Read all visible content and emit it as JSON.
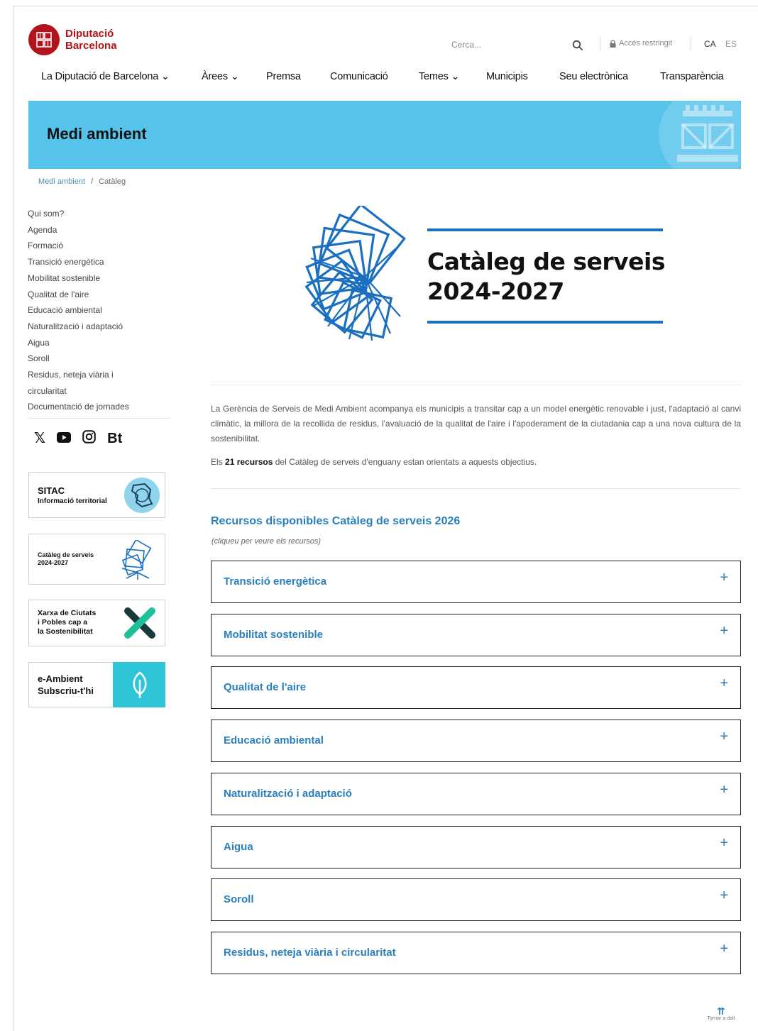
{
  "header": {
    "logo_line1": "Diputació",
    "logo_line2": "Barcelona",
    "search_placeholder": "Cerca...",
    "restricted": "Accés restringit",
    "lang_active": "CA",
    "lang_alt": "ES"
  },
  "nav": {
    "items": [
      {
        "label": "La Diputació de Barcelona ⌄"
      },
      {
        "label": "Àrees ⌄"
      },
      {
        "label": "Premsa"
      },
      {
        "label": "Comunicació"
      },
      {
        "label": "Temes ⌄"
      },
      {
        "label": "Municipis"
      },
      {
        "label": "Seu electrònica"
      },
      {
        "label": "Transparència"
      }
    ]
  },
  "banner": {
    "title": "Medi ambient"
  },
  "breadcrumb": {
    "home": "Medi ambient",
    "separator": "/",
    "current": "Catàleg"
  },
  "sidebar": {
    "items": [
      {
        "label": "Qui som?"
      },
      {
        "label": "Agenda"
      },
      {
        "label": "Formació"
      },
      {
        "label": "Transició energètica"
      },
      {
        "label": "Mobilitat sostenible"
      },
      {
        "label": "Qualitat de l'aire"
      },
      {
        "label": "Educació ambiental"
      },
      {
        "label": "Naturalització i adaptació"
      },
      {
        "label": "Aigua"
      },
      {
        "label": "Soroll"
      },
      {
        "label": "Residus, neteja viària i"
      },
      {
        "label": "circularitat"
      },
      {
        "label": "Documentació de jornades"
      }
    ],
    "social": {
      "x": "𝕏",
      "youtube": "▶",
      "instagram": "◎",
      "bt": "Bt"
    },
    "cards": {
      "sitac_title": "SITAC",
      "sitac_sub": "Informació territorial",
      "cataleg_line1": "Catàleg de serveis",
      "cataleg_line2": "2024-2027",
      "xarxa_line1": "Xarxa de Ciutats",
      "xarxa_line2": "i Pobles cap a",
      "xarxa_line3": "la Sostenibilitat",
      "eamb_line1": "e-Ambient",
      "eamb_line2": "Subscriu-t'hi"
    }
  },
  "hero": {
    "title_line1": "Catàleg de serveis",
    "title_line2": "2024-2027"
  },
  "main": {
    "intro": "La Gerència de Serveis de Medi Ambient acompanya els municipis a transitar cap a un model energètic renovable i just, l'adaptació al canvi climàtic, la millora de la recollida de residus, l'avaluació de la qualitat de l'aire i l'apoderament de la ciutadania cap a una nova cultura de la sostenibilitat.",
    "count_prefix": "Els ",
    "count_bold": "21 recursos",
    "count_suffix": " del Catàleg de serveis d'enguany estan orientats a aquests objectius.",
    "resources_title": "Recursos disponibles Catàleg de serveis 2026",
    "resources_hint": "(cliqueu per veure els recursos)",
    "accordion": [
      {
        "label": "Transició energètica"
      },
      {
        "label": "Mobilitat sostenible"
      },
      {
        "label": "Qualitat de l'aire"
      },
      {
        "label": "Educació ambiental"
      },
      {
        "label": "Naturalització i adaptació"
      },
      {
        "label": "Aigua"
      },
      {
        "label": "Soroll"
      },
      {
        "label": "Residus, neteja viària i circularitat"
      }
    ],
    "plus": "+"
  },
  "footer": {
    "back_arrow": "⇈",
    "back_label": "Tornar a dalt"
  },
  "colors": {
    "brand_red": "#b3141c",
    "banner_blue": "#56c3ea",
    "link_blue": "#2a7fbf",
    "hero_blue": "#1a6fc0"
  }
}
